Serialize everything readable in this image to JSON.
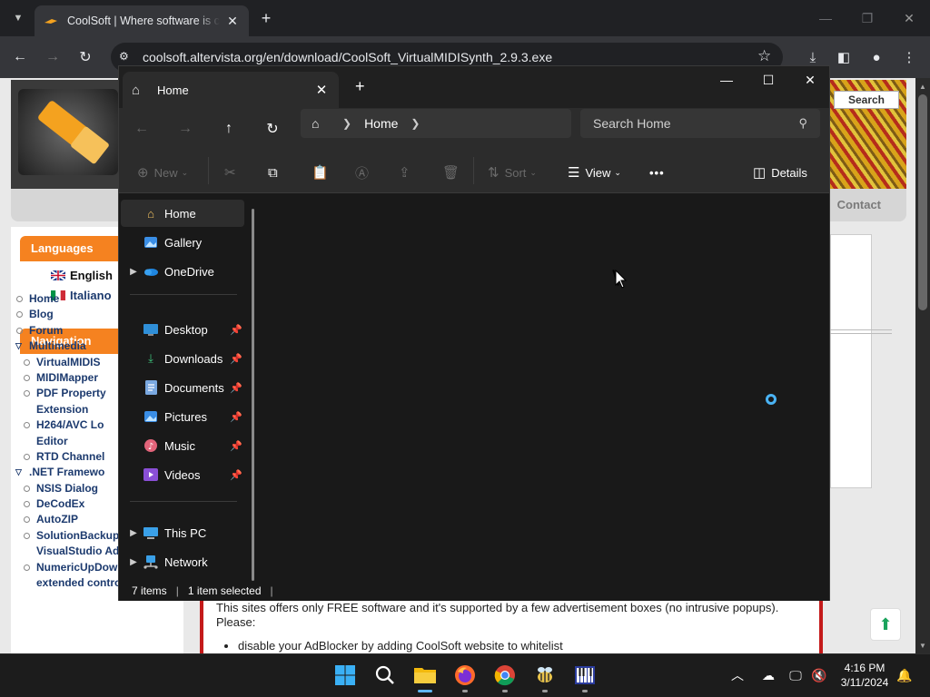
{
  "browser": {
    "tab_title": "CoolSoft | Where software is coming",
    "url": "coolsoft.altervista.org/en/download/CoolSoft_VirtualMIDISynth_2.9.3.exe"
  },
  "website": {
    "search_button": "Search",
    "nav_contact": "Contact",
    "languages_heading": "Languages",
    "languages": [
      "English",
      "Italiano"
    ],
    "navigation_heading": "Navigation",
    "nav_items": [
      {
        "label": "Home",
        "level": 0
      },
      {
        "label": "Blog",
        "level": 0
      },
      {
        "label": "Forum",
        "level": 0
      },
      {
        "label": "Multimedia",
        "level": 0,
        "expanded": true
      },
      {
        "label": "VirtualMIDIS",
        "level": 1
      },
      {
        "label": "MIDIMapper",
        "level": 1
      },
      {
        "label": "PDF Property",
        "level": 1
      },
      {
        "label": "Extension",
        "level": 2
      },
      {
        "label": "H264/AVC Lo",
        "level": 1
      },
      {
        "label": "Editor",
        "level": 2
      },
      {
        "label": "RTD Channel",
        "level": 1
      },
      {
        "label": ".NET Framewo",
        "level": 0,
        "expanded": true
      },
      {
        "label": "NSIS Dialog",
        "level": 1
      },
      {
        "label": "DeCodEx",
        "level": 1
      },
      {
        "label": "AutoZIP",
        "level": 1
      },
      {
        "label": "SolutionBackup",
        "level": 1
      },
      {
        "label": "VisualStudio Addin",
        "level": 2
      },
      {
        "label": "NumericUpDown",
        "level": 1
      },
      {
        "label": "extended control",
        "level": 2
      }
    ],
    "notice_text": "This sites offers only FREE software and it's supported by a few advertisement boxes (no intrusive popups). Please:",
    "notice_bullet": "disable your AdBlocker by adding CoolSoft website to whitelist"
  },
  "explorer": {
    "tab_label": "Home",
    "breadcrumb": "Home",
    "search_placeholder": "Search Home",
    "commands": {
      "new": "New",
      "sort": "Sort",
      "view": "View",
      "more": "•••",
      "details": "Details"
    },
    "nav_pane": {
      "quick": [
        {
          "label": "Home",
          "icon": "home-icon",
          "selected": true
        },
        {
          "label": "Gallery",
          "icon": "gallery-icon"
        },
        {
          "label": "OneDrive",
          "icon": "onedrive-icon",
          "expandable": true
        }
      ],
      "pinned": [
        {
          "label": "Desktop",
          "icon": "desktop-icon"
        },
        {
          "label": "Downloads",
          "icon": "downloads-icon"
        },
        {
          "label": "Documents",
          "icon": "documents-icon"
        },
        {
          "label": "Pictures",
          "icon": "pictures-icon"
        },
        {
          "label": "Music",
          "icon": "music-icon"
        },
        {
          "label": "Videos",
          "icon": "videos-icon"
        }
      ],
      "locations": [
        {
          "label": "This PC",
          "icon": "this-pc-icon"
        },
        {
          "label": "Network",
          "icon": "network-icon"
        }
      ]
    },
    "status": {
      "items": "7 items",
      "selected": "1 item selected"
    }
  },
  "taskbar": {
    "time": "4:16 PM",
    "date": "3/11/2024"
  },
  "colors": {
    "accent_orange": "#f58220",
    "explorer_bg": "#191919",
    "spinner_blue": "#4ab3f4"
  }
}
